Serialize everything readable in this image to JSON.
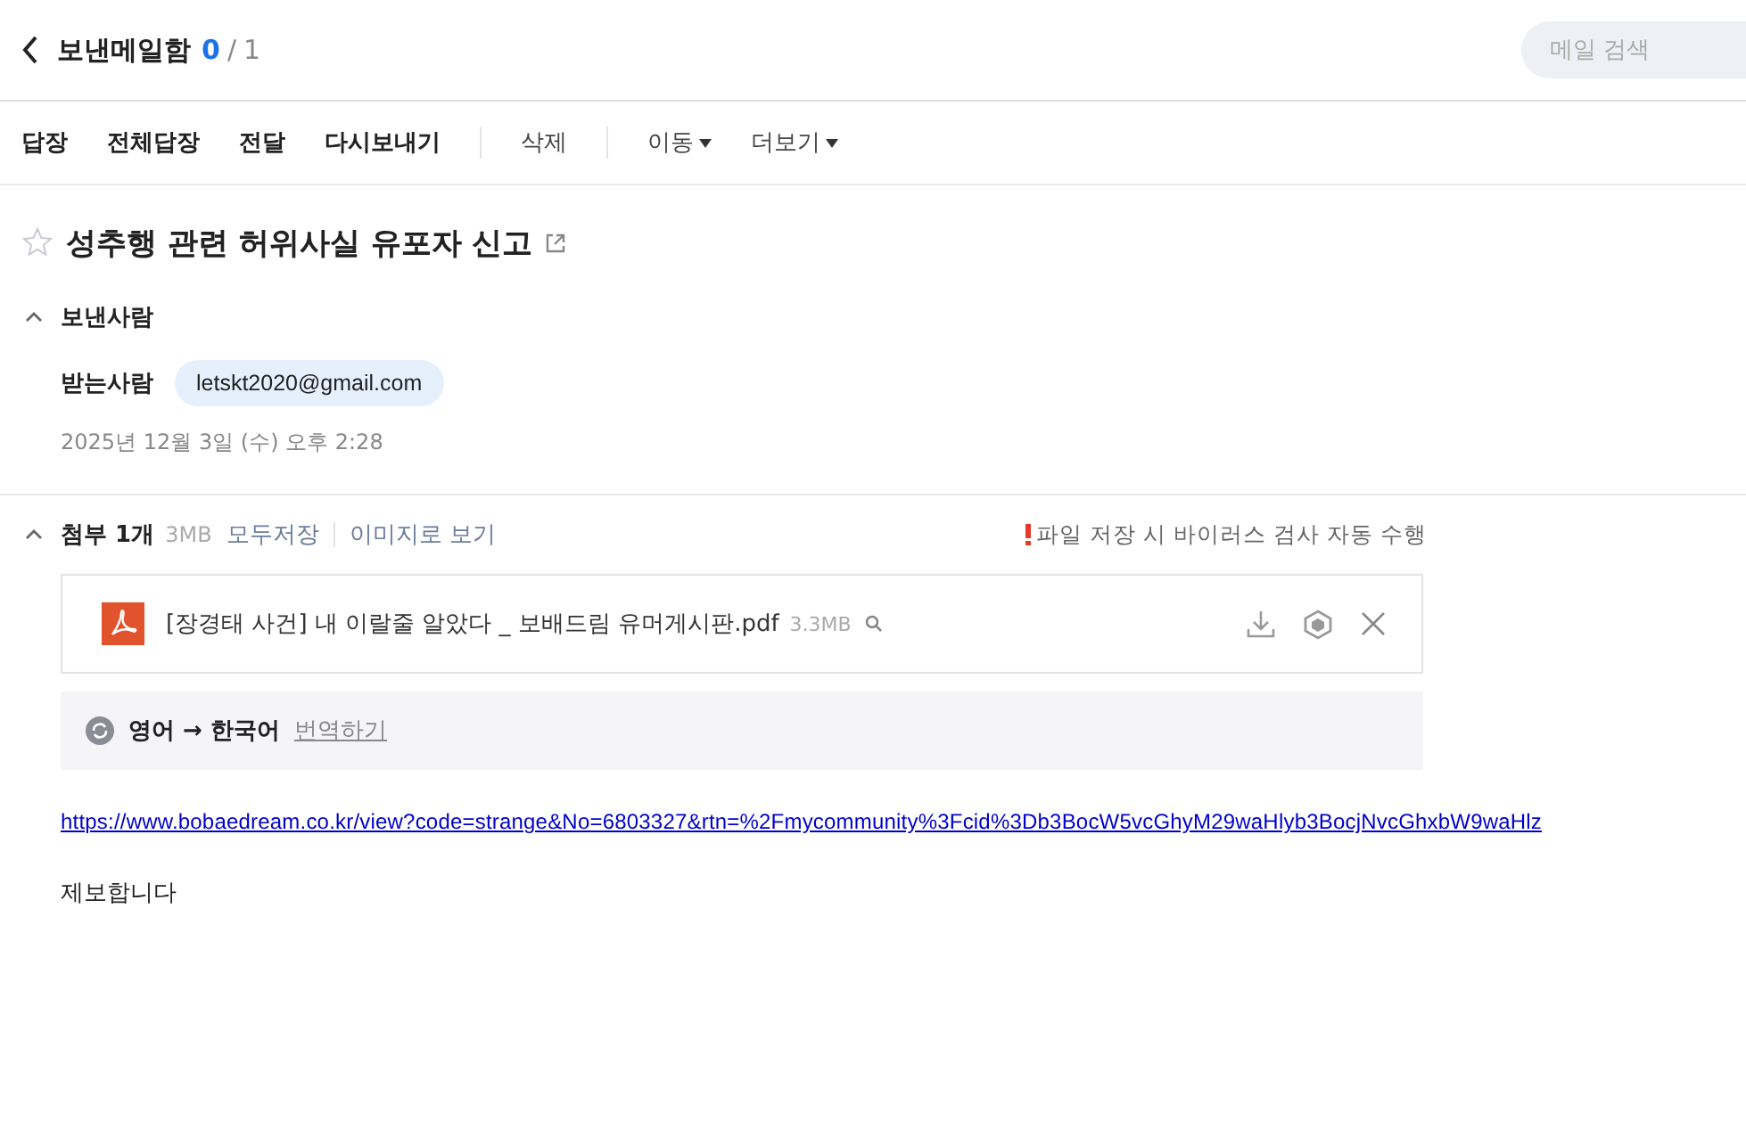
{
  "header": {
    "title": "보낸메일함",
    "counter": {
      "current": "0",
      "separator": "/",
      "total": "1"
    },
    "search": {
      "placeholder": "메일 검색"
    }
  },
  "toolbar": [
    {
      "label": "답장",
      "kind": "primary"
    },
    {
      "label": "전체답장",
      "kind": "primary"
    },
    {
      "label": "전달",
      "kind": "primary"
    },
    {
      "label": "다시보내기",
      "kind": "primary"
    },
    {
      "label": "삭제",
      "kind": "plain",
      "separator_before": true
    },
    {
      "label": "이동",
      "kind": "menu",
      "separator_before": true
    },
    {
      "label": "더보기",
      "kind": "menu"
    }
  ],
  "mail": {
    "subject": "성추행 관련 허위사실 유포자 신고",
    "starred": false,
    "sender_section": {
      "label": "보낸사람",
      "expanded": true
    },
    "recipient": {
      "label": "받는사람",
      "address": "letskt2020@gmail.com"
    },
    "date": "2025년 12월 3일 (수) 오후 2:28",
    "attachments": {
      "label": "첨부 1개",
      "size": "3MB",
      "expanded": true,
      "save_all": "모두저장",
      "view_as_image": "이미지로 보기",
      "warning": "파일 저장 시 바이러스 검사 자동 수행",
      "files": [
        {
          "name": "[장경태 사건] 내 이랄줄 알았다 _ 보배드림 유머게시판.pdf",
          "size": "3.3MB"
        }
      ]
    },
    "translation": {
      "languages": "영어 → 한국어",
      "action": "번역하기"
    },
    "body": {
      "link": "https://www.bobaedream.co.kr/view?code=strange&No=6803327&rtn=%2Fmycommunity%3Fcid%3Db3BocW5vcGhyM29waHlyb3BocjNvcGhxbW9waHlz",
      "text": "제보합니다"
    }
  }
}
